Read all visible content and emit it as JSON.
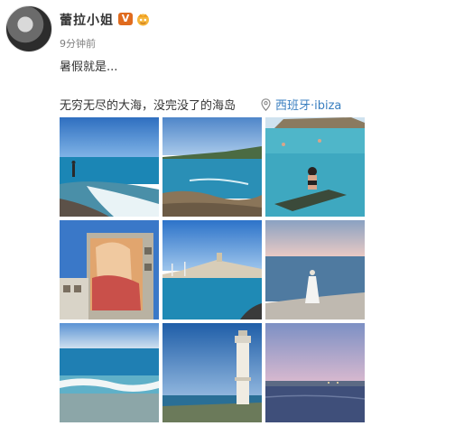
{
  "post": {
    "author_name": "蕾拉小姐",
    "verified_badge": "V",
    "timestamp": "9分钟前",
    "line1": "暑假就是...",
    "line2": "无穷无尽的大海，没完没了的海岛",
    "location": "西班牙·ibiza"
  },
  "icons": {
    "avatar": "profile-photo",
    "verified": "verified-v-icon",
    "member": "crown-member-icon",
    "location": "location-pin-icon"
  },
  "colors": {
    "link": "#3a7fc0",
    "badge": "#e06b1e",
    "meta": "#808080"
  },
  "photos": [
    {
      "scene": "beach-person"
    },
    {
      "scene": "coastal-cliffs"
    },
    {
      "scene": "woman-on-float"
    },
    {
      "scene": "mural-building"
    },
    {
      "scene": "harbor-town"
    },
    {
      "scene": "woman-white-dress"
    },
    {
      "scene": "sea-waves"
    },
    {
      "scene": "lighthouse"
    },
    {
      "scene": "dusk-shore"
    }
  ]
}
